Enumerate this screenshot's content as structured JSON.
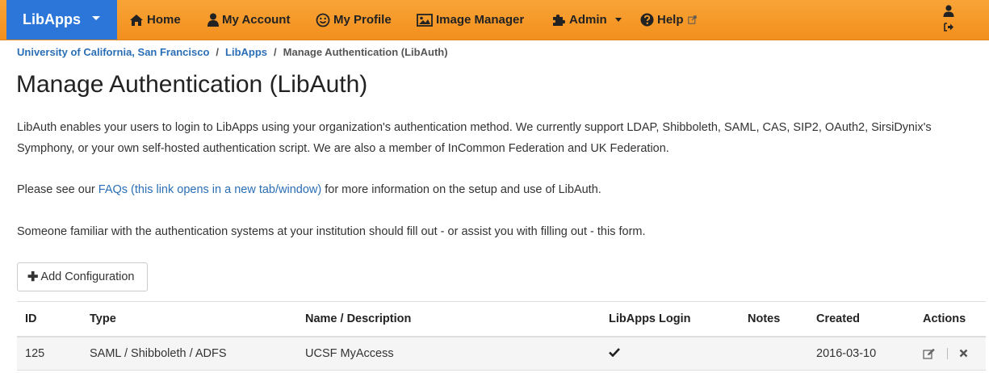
{
  "nav": {
    "brand": "LibApps",
    "home": "Home",
    "account": "My Account",
    "profile": "My Profile",
    "images": "Image Manager",
    "admin": "Admin",
    "help": "Help",
    "colors": {
      "bar": "#f39a2a",
      "brand": "#2b76d8",
      "link": "#2a6eb6"
    }
  },
  "breadcrumb": {
    "org": "University of California, San Francisco",
    "app": "LibApps",
    "current": "Manage Authentication (LibAuth)"
  },
  "page": {
    "title": "Manage Authentication (LibAuth)",
    "intro": "LibAuth enables your users to login to LibApps using your organization's authentication method. We currently support LDAP, Shibboleth, SAML, CAS, SIP2, OAuth2, SirsiDynix's Symphony, or your own self-hosted authentication script. We are also a member of InCommon Federation and UK Federation.",
    "faq_prefix": "Please see our ",
    "faq_link": "FAQs (this link opens in a new tab/window)",
    "faq_suffix": " for more information on the setup and use of LibAuth.",
    "notice": "Someone familiar with the authentication systems at your institution should fill out - or assist you with filling out - this form.",
    "add_button": "Add Configuration"
  },
  "table": {
    "headers": {
      "id": "ID",
      "type": "Type",
      "name": "Name / Description",
      "login": "LibApps Login",
      "notes": "Notes",
      "created": "Created",
      "actions": "Actions"
    },
    "rows": [
      {
        "id": "125",
        "type": "SAML / Shibboleth / ADFS",
        "name": "UCSF MyAccess",
        "login_icon": "check-icon",
        "notes": "",
        "created": "2016-03-10"
      }
    ]
  }
}
